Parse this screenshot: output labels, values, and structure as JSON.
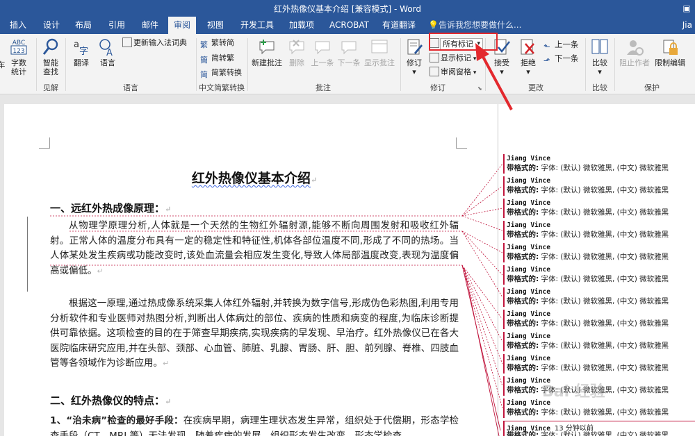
{
  "window": {
    "title": "红外热像仪基本介绍 [兼容模式] - Word"
  },
  "tabs": [
    "插入",
    "设计",
    "布局",
    "引用",
    "邮件",
    "审阅",
    "视图",
    "开发工具",
    "加载项",
    "ACROBAT",
    "有道翻译"
  ],
  "tell_me": "告诉我您想要做什么...",
  "account": "Jia",
  "ribbon": {
    "proofing": {
      "word_count_top": "ABC\n123",
      "word_count": "字数\n统计",
      "left_cut": "车"
    },
    "insights": {
      "smart_lookup": "智能\n查找",
      "group": "见解"
    },
    "language": {
      "translate": "翻译",
      "language": "语言",
      "update_ime": "更新输入法词典",
      "group": "语言"
    },
    "chinese": {
      "to_trad": "繁转简",
      "to_simp": "简转繁",
      "convert": "简繁转换",
      "group": "中文简繁转换"
    },
    "comments": {
      "new": "新建批注",
      "delete": "删除",
      "prev": "上一条",
      "next": "下一条",
      "show": "显示批注",
      "group": "批注"
    },
    "tracking": {
      "track": "修订",
      "markup_value": "所有标记",
      "show_markup": "显示标记",
      "review_pane": "审阅窗格",
      "group": "修订"
    },
    "changes": {
      "accept": "接受",
      "reject": "拒绝",
      "prev": "上一条",
      "next": "下一条",
      "group": "更改"
    },
    "compare": {
      "compare": "比较",
      "group": "比较"
    },
    "protect": {
      "block_authors": "阻止作者",
      "restrict": "限制编辑",
      "group": "保护"
    }
  },
  "document": {
    "title": "红外热像仪基本介绍",
    "heading1": "一、远红外热成像原理：",
    "para1": "从物理学原理分析,人体就是一个天然的生物红外辐射源,能够不断向周围发射和吸收红外辐射。正常人体的温度分布具有一定的稳定性和特征性,机体各部位温度不同,形成了不同的热场。当人体某处发生疾病或功能改变时,该处血流量会相应发生变化,导致人体局部温度改变,表现为温度偏高或偏低。",
    "para2": "根据这一原理,通过热成像系统采集人体红外辐射,并转换为数字信号,形成伪色彩热图,利用专用分析软件和专业医师对热图分析,判断出人体病灶的部位、疾病的性质和病变的程度,为临床诊断提供可靠依据。这项检查的目的在于筛查早期疾病,实现疾病的早发现、早治疗。红外热像仪已在各大医院临床研究应用,并在头部、颈部、心血管、肺脏、乳腺、胃肠、肝、胆、前列腺、脊椎、四肢血管等各领域作为诊断应用。",
    "heading2": "二、红外热像仪的特点：",
    "para3_bold": "1、“治未病”检查的最好手段：",
    "para3": "在疾病早期，病理生理状态发生异常，组织处于代偿期，形态学检查手段（CT、MRI 等）无法发现。随着疾病的发展，组织形态发生改变，形态学检查"
  },
  "comments": {
    "author": "Jiang Vince",
    "label": "带格式的:",
    "text": " 字体: (默认) 微软雅黑, (中文) 微软雅黑",
    "last_time": "13 分钟以前"
  },
  "watermark": "Bai 经验"
}
